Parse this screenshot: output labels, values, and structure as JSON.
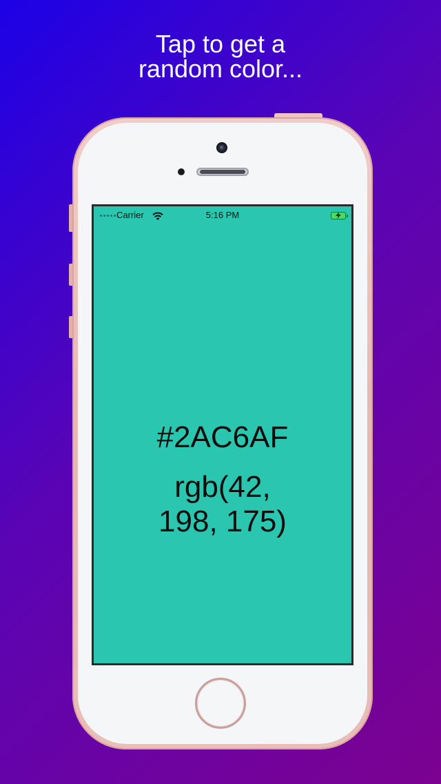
{
  "headline": {
    "line1": "Tap to get a",
    "line2": "random color..."
  },
  "statusbar": {
    "carrier": "Carrier",
    "time": "5:16 PM",
    "wifi_icon": "wifi-icon",
    "battery_icon": "battery-charging-icon"
  },
  "color": {
    "hex": "#2AC6AF",
    "rgb_line1": "rgb(42,",
    "rgb_line2": "198, 175)",
    "swatch": "#2AC6AF"
  },
  "colors": {
    "background_start": "#1c02e6",
    "background_end": "#7c0290",
    "phone_frame": "#e9bdb8",
    "text": "#0d0d0d"
  }
}
